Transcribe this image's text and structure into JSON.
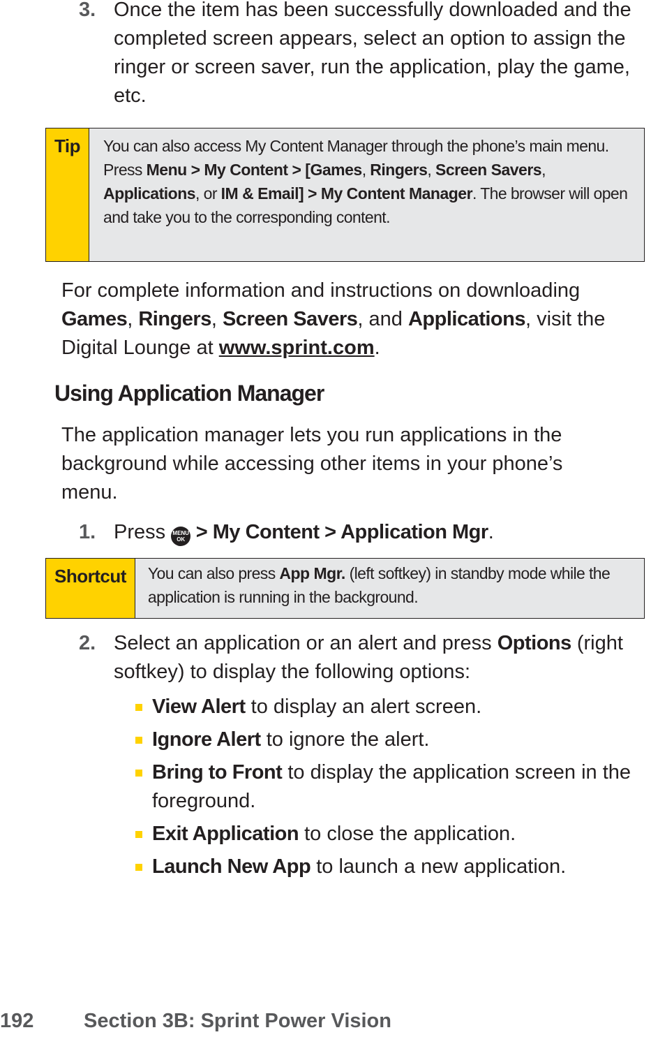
{
  "step3": {
    "number": "3.",
    "text": "Once the item has been successfully downloaded and the completed screen appears, select an option to assign the ringer or screen saver, run the application, play the game, etc."
  },
  "tip": {
    "label": "Tip",
    "t1": "You can also access My Content Manager through the phone’s main menu. Press ",
    "b1": "Menu > My Content > [Games",
    "t2": ", ",
    "b2": "Ringers",
    "t3": ", ",
    "b3": "Screen Savers",
    "t4": ", ",
    "b4": "Applications",
    "t5": ", or ",
    "b5": "IM & Email] > My Content Manager",
    "t6": ". The browser will open and take you to the corresponding content."
  },
  "info_para": {
    "t1": "For complete information and instructions on downloading ",
    "b1": "Games",
    "t2": ", ",
    "b2": "Ringers",
    "t3": ", ",
    "b3": "Screen Savers",
    "t4": ", and ",
    "b4": "Applications",
    "t5": ", visit the Digital Lounge at ",
    "link": "www.sprint.com",
    "t6": "."
  },
  "heading": "Using Application Manager",
  "intro": "The application manager lets you run applications in the background while accessing other items in your phone’s menu.",
  "step1": {
    "number": "1.",
    "t1": "Press ",
    "icon_top": "MENU",
    "icon_bottom": "OK",
    "b1": " > My Content > Application Mgr",
    "t2": "."
  },
  "shortcut": {
    "label": "Shortcut",
    "t1": "You can also press ",
    "b1": "App Mgr.",
    "t2": " (left softkey) in standby mode while the application is running in the background."
  },
  "step2": {
    "number": "2.",
    "t1": "Select an application or an alert and press ",
    "b1": "Options",
    "t2": " (right softkey) to display the following options:"
  },
  "options": [
    {
      "bold": "View Alert",
      "text": " to display an alert screen."
    },
    {
      "bold": "Ignore Alert",
      "text": " to ignore the alert."
    },
    {
      "bold": "Bring to Front",
      "text": " to display the application screen in the foreground."
    },
    {
      "bold": "Exit Application",
      "text": " to close the application."
    },
    {
      "bold": "Launch New App",
      "text": " to launch a new application."
    }
  ],
  "footer": {
    "page_number": "192",
    "section": "Section 3B: Sprint Power Vision"
  }
}
